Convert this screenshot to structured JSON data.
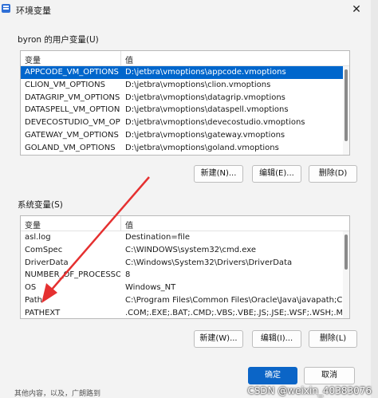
{
  "window": {
    "title": "环境变量",
    "close_glyph": "✕"
  },
  "user_vars": {
    "group_label": "byron 的用户变量(U)",
    "header": {
      "col1": "变量",
      "col2": "值"
    },
    "rows": [
      {
        "name": "APPCODE_VM_OPTIONS",
        "value": "D:\\jetbra\\vmoptions\\appcode.vmoptions",
        "selected": true
      },
      {
        "name": "CLION_VM_OPTIONS",
        "value": "D:\\jetbra\\vmoptions\\clion.vmoptions"
      },
      {
        "name": "DATAGRIP_VM_OPTIONS",
        "value": "D:\\jetbra\\vmoptions\\datagrip.vmoptions"
      },
      {
        "name": "DATASPELL_VM_OPTIONS",
        "value": "D:\\jetbra\\vmoptions\\dataspell.vmoptions"
      },
      {
        "name": "DEVECOSTUDIO_VM_OPT...",
        "value": "D:\\jetbra\\vmoptions\\devecostudio.vmoptions"
      },
      {
        "name": "GATEWAY_VM_OPTIONS",
        "value": "D:\\jetbra\\vmoptions\\gateway.vmoptions"
      },
      {
        "name": "GOLAND_VM_OPTIONS",
        "value": "D:\\jetbra\\vmoptions\\goland.vmoptions"
      }
    ],
    "buttons": {
      "new": "新建(N)...",
      "edit": "编辑(E)...",
      "delete": "删除(D)"
    }
  },
  "system_vars": {
    "group_label": "系统变量(S)",
    "header": {
      "col1": "变量",
      "col2": "值"
    },
    "rows": [
      {
        "name": "asl.log",
        "value": "Destination=file"
      },
      {
        "name": "ComSpec",
        "value": "C:\\WINDOWS\\system32\\cmd.exe"
      },
      {
        "name": "DriverData",
        "value": "C:\\Windows\\System32\\Drivers\\DriverData"
      },
      {
        "name": "NUMBER_OF_PROCESSORS",
        "value": "8"
      },
      {
        "name": "OS",
        "value": "Windows_NT"
      },
      {
        "name": "Path",
        "value": "C:\\Program Files\\Common Files\\Oracle\\Java\\javapath;C:\\Win..."
      },
      {
        "name": "PATHEXT",
        "value": ".COM;.EXE;.BAT;.CMD;.VBS;.VBE;.JS;.JSE;.WSF;.WSH;.MSC"
      }
    ],
    "buttons": {
      "new": "新建(W)...",
      "edit": "编辑(I)...",
      "delete": "删除(L)"
    }
  },
  "footer": {
    "ok": "确定",
    "cancel": "取消"
  },
  "watermark": "CSDN @weixin_40383076",
  "bottom_text": "其他内容，以及，广朗路到",
  "colors": {
    "selection": "#0066cc",
    "arrow": "#e53030",
    "primary_button": "#0b65c7"
  }
}
